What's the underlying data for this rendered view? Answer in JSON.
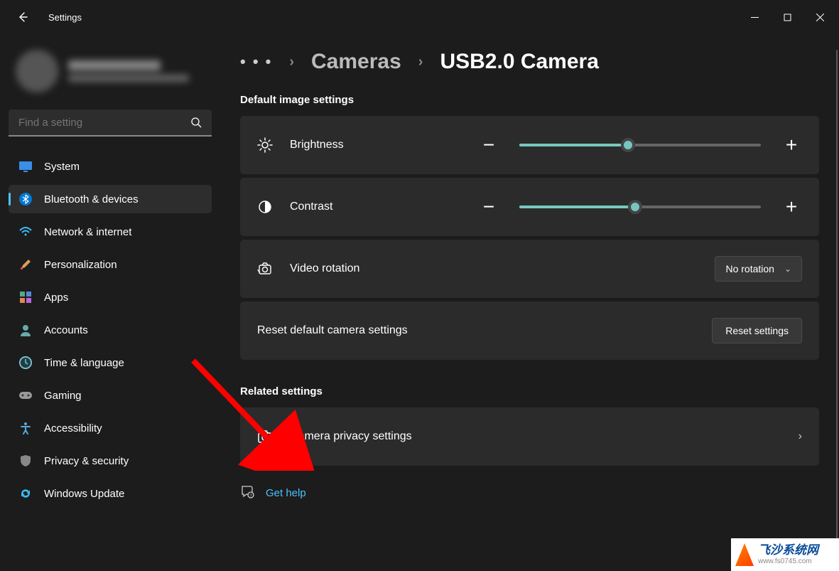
{
  "app_title": "Settings",
  "search": {
    "placeholder": "Find a setting"
  },
  "sidebar": {
    "items": [
      {
        "label": "System",
        "icon": "monitor"
      },
      {
        "label": "Bluetooth & devices",
        "icon": "bluetooth",
        "active": true
      },
      {
        "label": "Network & internet",
        "icon": "wifi"
      },
      {
        "label": "Personalization",
        "icon": "brush"
      },
      {
        "label": "Apps",
        "icon": "apps"
      },
      {
        "label": "Accounts",
        "icon": "person"
      },
      {
        "label": "Time & language",
        "icon": "clock"
      },
      {
        "label": "Gaming",
        "icon": "gamepad"
      },
      {
        "label": "Accessibility",
        "icon": "accessibility"
      },
      {
        "label": "Privacy & security",
        "icon": "shield"
      },
      {
        "label": "Windows Update",
        "icon": "update"
      }
    ]
  },
  "breadcrumb": {
    "overflow": "• • •",
    "parent": "Cameras",
    "current": "USB2.0 Camera"
  },
  "sections": {
    "default_image": "Default image settings",
    "related": "Related settings"
  },
  "brightness": {
    "label": "Brightness",
    "slider_percent": 45
  },
  "contrast": {
    "label": "Contrast",
    "slider_percent": 48
  },
  "rotation": {
    "label": "Video rotation",
    "selected": "No rotation"
  },
  "reset": {
    "label": "Reset default camera settings",
    "button": "Reset settings"
  },
  "privacy": {
    "label": "Camera privacy settings"
  },
  "help": {
    "label": "Get help"
  },
  "watermark": {
    "cn": "飞沙系统网",
    "url": "www.fs0745.com"
  }
}
